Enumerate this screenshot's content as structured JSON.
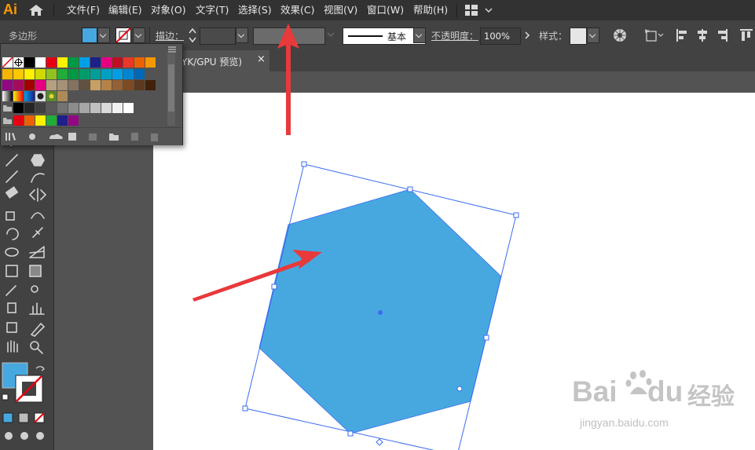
{
  "app": {
    "logo": "Ai"
  },
  "menu": [
    "文件(F)",
    "编辑(E)",
    "对象(O)",
    "文字(T)",
    "选择(S)",
    "效果(C)",
    "视图(V)",
    "窗口(W)",
    "帮助(H)"
  ],
  "control": {
    "shape_label": "多边形",
    "stroke_label": "描边：",
    "brush_label": "基本",
    "opacity_label": "不透明度：",
    "opacity_value": "100%",
    "style_label": "样式："
  },
  "document": {
    "tab_title": "YK/GPU 预览)",
    "close": "×"
  },
  "colors": {
    "fill": "#47a8e0",
    "selection": "#3a6cf0",
    "arrow": "#e8393b",
    "ui_dark": "#323232",
    "ui_mid": "#424242",
    "pasteboard": "#535353"
  },
  "swatches": {
    "row1": [
      "#000000",
      "#ffffff",
      "#e60012",
      "#fff100",
      "#009944",
      "#00a0e9",
      "#1d2088",
      "#e4007f",
      "#c30d23",
      "#e83828",
      "#eb6100",
      "#f39800"
    ],
    "row2": [
      "#f8b500",
      "#fcc800",
      "#fff100",
      "#cfdb00",
      "#8fc31f",
      "#22ac38",
      "#009944",
      "#009b6b",
      "#009e96",
      "#00a0c1",
      "#00a0e9",
      "#0086d1",
      "#0068b7"
    ],
    "row3": [
      "#920783",
      "#a40b5d",
      "#a40000",
      "#e4007f",
      "#b7a07e",
      "#a59178",
      "#837360",
      "#605142",
      "#c79f62",
      "#b28247",
      "#946134",
      "#7c4a24",
      "#5b3a1f",
      "#42210b"
    ],
    "row5": [
      "#000000",
      "#262626",
      "#404040",
      "#595959",
      "#737373",
      "#8c8c8c",
      "#a6a6a6",
      "#bfbfbf",
      "#d9d9d9",
      "#f2f2f2",
      "#ffffff"
    ],
    "row6": [
      "#e60012",
      "#eb6100",
      "#fff100",
      "#22ac38",
      "#1d2088",
      "#920783"
    ]
  },
  "watermark": {
    "brand_b": "Bai",
    "brand_du": "du",
    "cn": "经验",
    "url": "jingyan.baidu.com"
  }
}
